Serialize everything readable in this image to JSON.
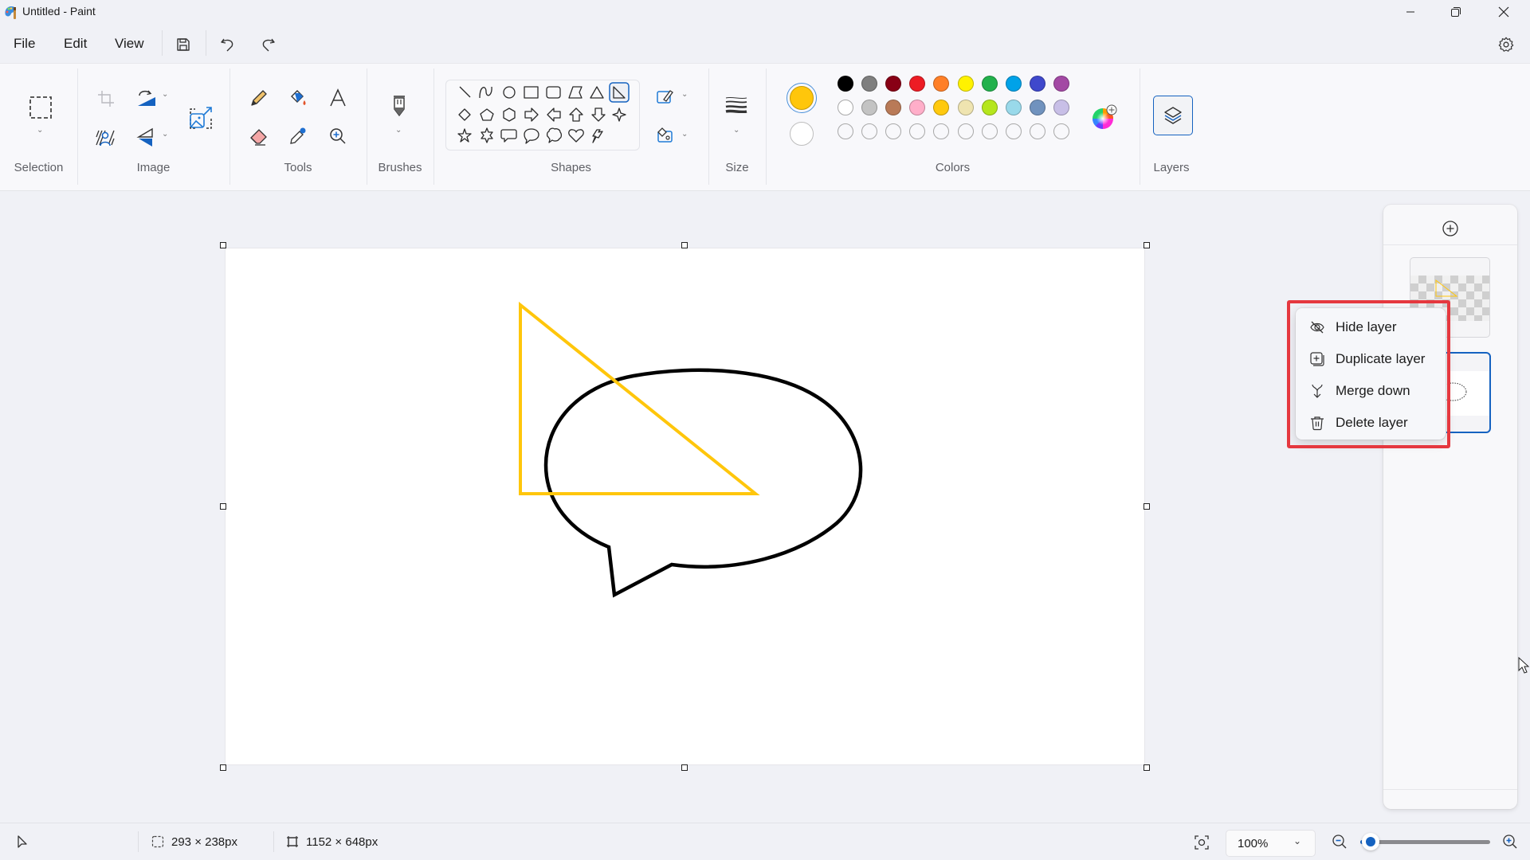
{
  "app": {
    "title": "Untitled - Paint",
    "icon": "paint-palette-icon"
  },
  "window_controls": {
    "minimize": "minimize-icon",
    "maximize": "restore-icon",
    "close": "close-icon"
  },
  "menubar": {
    "items": [
      {
        "label": "File"
      },
      {
        "label": "Edit"
      },
      {
        "label": "View"
      }
    ],
    "quick_actions": [
      "save-icon",
      "undo-icon",
      "redo-icon"
    ],
    "settings": "gear-icon"
  },
  "ribbon": {
    "groups": [
      {
        "label": "Selection"
      },
      {
        "label": "Image"
      },
      {
        "label": "Tools"
      },
      {
        "label": "Brushes"
      },
      {
        "label": "Shapes"
      },
      {
        "label": "Size"
      },
      {
        "label": "Colors"
      },
      {
        "label": "Layers"
      }
    ],
    "image_tools": [
      "crop",
      "rotate",
      "remove-background",
      "flip",
      "resize"
    ],
    "tools": [
      "pencil",
      "fill",
      "text",
      "eraser",
      "color-picker",
      "magnifier"
    ],
    "shapes": [
      "line",
      "curve",
      "oval",
      "rectangle",
      "rounded-rectangle",
      "polygon",
      "triangle",
      "right-triangle",
      "diamond",
      "pentagon",
      "hexagon",
      "right-arrow",
      "left-arrow",
      "up-arrow",
      "down-arrow",
      "four-point-star",
      "five-point-star",
      "six-point-star",
      "rounded-rectangular-callout",
      "oval-callout",
      "cloud-callout",
      "heart",
      "lightning"
    ],
    "selected_shape": "right-triangle",
    "colors": {
      "primary": "#FFC60B",
      "secondary": "#FFFFFF",
      "palette_row1": [
        "#000000",
        "#7F7F7F",
        "#880015",
        "#ED1C24",
        "#FF7F27",
        "#FFF200",
        "#22B14C",
        "#00A2E8",
        "#3F48CC",
        "#A349A4"
      ],
      "palette_row2": [
        "#FFFFFF",
        "#C3C3C3",
        "#B97A57",
        "#FFAEC9",
        "#FFC90E",
        "#EFE4B0",
        "#B5E61D",
        "#99D9EA",
        "#7092BE",
        "#C8BFE7"
      ],
      "palette_row3_empty_count": 10
    }
  },
  "canvas": {
    "drawing": {
      "triangle_color": "#FFC60B",
      "callout_color": "#000000"
    }
  },
  "layers_panel": {
    "add_layer": "add-layer-icon",
    "layers": [
      {
        "name": "layer-1",
        "selected": false
      },
      {
        "name": "layer-2",
        "selected": true
      }
    ]
  },
  "context_menu": {
    "items": [
      {
        "label": "Hide layer",
        "icon": "hide-icon"
      },
      {
        "label": "Duplicate layer",
        "icon": "duplicate-icon"
      },
      {
        "label": "Merge down",
        "icon": "merge-down-icon"
      },
      {
        "label": "Delete layer",
        "icon": "delete-icon"
      }
    ]
  },
  "statusbar": {
    "selection_size": "293 × 238px",
    "canvas_size": "1152 × 648px",
    "zoom_level": "100%",
    "zoom_slider_fraction": 0.08
  }
}
